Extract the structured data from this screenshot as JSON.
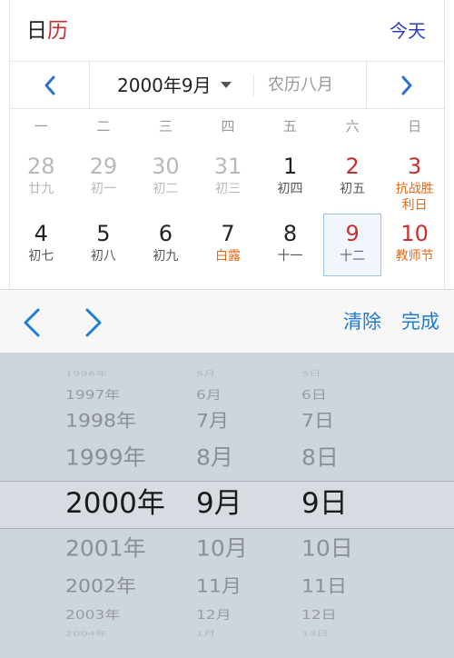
{
  "header": {
    "title_1": "日",
    "title_2": "历",
    "today": "今天"
  },
  "nav": {
    "month": "2000年9月",
    "lunar": "农历八月"
  },
  "weekdays": [
    "一",
    "二",
    "三",
    "四",
    "五",
    "六",
    "日"
  ],
  "rows": [
    [
      {
        "num": "28",
        "lunar": "廿九",
        "type": "other"
      },
      {
        "num": "29",
        "lunar": "初一",
        "type": "other"
      },
      {
        "num": "30",
        "lunar": "初二",
        "type": "other"
      },
      {
        "num": "31",
        "lunar": "初三",
        "type": "other"
      },
      {
        "num": "1",
        "lunar": "初四",
        "type": ""
      },
      {
        "num": "2",
        "lunar": "初五",
        "type": "weekend"
      },
      {
        "num": "3",
        "lunar": "抗战胜利日",
        "type": "holiday"
      }
    ],
    [
      {
        "num": "4",
        "lunar": "初七",
        "type": ""
      },
      {
        "num": "5",
        "lunar": "初八",
        "type": ""
      },
      {
        "num": "6",
        "lunar": "初九",
        "type": ""
      },
      {
        "num": "7",
        "lunar": "白露",
        "type": "term"
      },
      {
        "num": "8",
        "lunar": "十一",
        "type": ""
      },
      {
        "num": "9",
        "lunar": "十二",
        "type": "selected"
      },
      {
        "num": "10",
        "lunar": "教师节",
        "type": "holiday"
      }
    ]
  ],
  "toolbar": {
    "clear": "清除",
    "done": "完成"
  },
  "picker": {
    "years": [
      "1996年",
      "1997年",
      "1998年",
      "1999年",
      "2000年",
      "2001年",
      "2002年",
      "2003年",
      "2004年"
    ],
    "months": [
      "5月",
      "6月",
      "7月",
      "8月",
      "9月",
      "10月",
      "11月",
      "12月",
      "1月"
    ],
    "days": [
      "5日",
      "6日",
      "7日",
      "8日",
      "9日",
      "10日",
      "11日",
      "12日",
      "13日"
    ],
    "selected_index": 4
  },
  "colors": {
    "accent_red": "#c8302d",
    "accent_orange": "#e06a17",
    "link_blue": "#1e7cd4",
    "today_blue": "#2b3fb8"
  }
}
